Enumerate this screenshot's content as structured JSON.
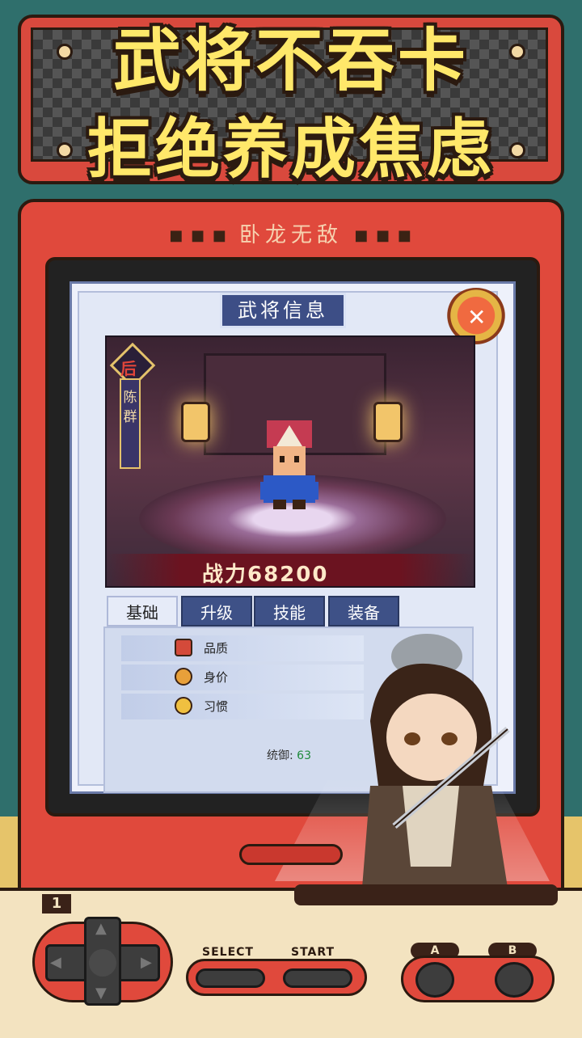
{
  "headline": {
    "line1": "武将不吞卡",
    "line2": "拒绝养成焦虑"
  },
  "console_brand": {
    "title": "卧龙无敌"
  },
  "panel": {
    "title": "武将信息",
    "rank_badge": "后",
    "general_name": "陈群",
    "power_text": "战力68200"
  },
  "tabs": [
    {
      "label": "基础",
      "active": true
    },
    {
      "label": "升级",
      "active": false
    },
    {
      "label": "技能",
      "active": false
    },
    {
      "label": "装备",
      "active": false
    }
  ],
  "attributes": [
    {
      "label": "品质",
      "icon": "quality-icon"
    },
    {
      "label": "身价",
      "icon": "value-crown-icon"
    },
    {
      "label": "习惯",
      "icon": "habit-icon"
    }
  ],
  "stat": {
    "label": "统御:",
    "value": "63"
  },
  "controller": {
    "player_label": "1",
    "select_label": "SELECT",
    "start_label": "START",
    "a_label": "A",
    "b_label": "B"
  },
  "colors": {
    "console_red": "#e0493c",
    "headline_yellow": "#ffe86a",
    "tab_blue": "#3e5187",
    "stat_green": "#1f8a3c"
  }
}
